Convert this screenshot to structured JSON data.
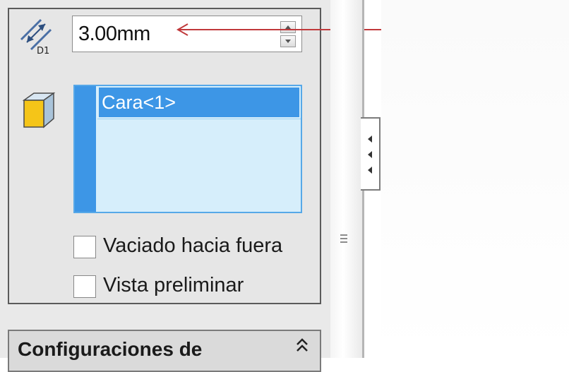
{
  "distance_field": {
    "dimension_label": "D1",
    "value": "3.00mm",
    "icon": "distance-dimension-icon"
  },
  "faces_selection": {
    "icon": "face-cube-icon",
    "items": [
      "Cara<1>"
    ]
  },
  "options": [
    {
      "label": "Vaciado hacia fuera",
      "checked": false
    },
    {
      "label": "Vista preliminar",
      "checked": false
    }
  ],
  "next_section": {
    "title": "Configuraciones de",
    "icon": "collapse-double-chevron-icon"
  },
  "colors": {
    "annotation_arrow": "#c0393b",
    "selection_highlight": "#3d96e6",
    "list_background": "#d6eefb",
    "face_icon": "#f2c21b"
  }
}
